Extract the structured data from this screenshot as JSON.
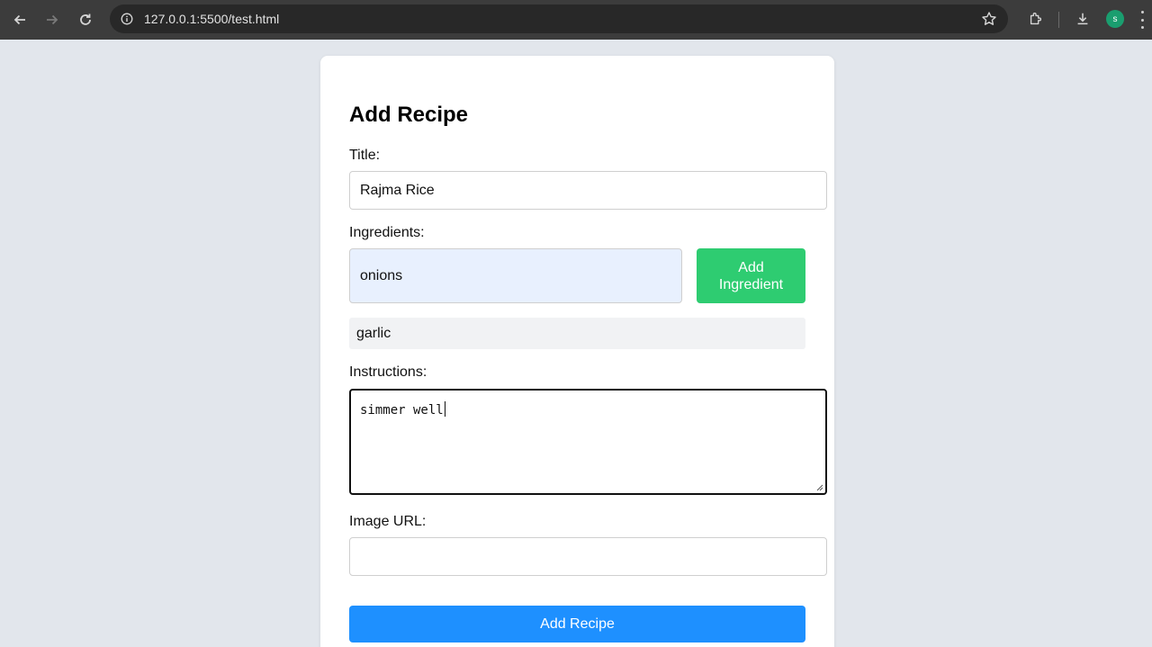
{
  "browser": {
    "url": "127.0.0.1:5500/test.html",
    "profile_initial": "s",
    "icons": {
      "back": "arrow-left-icon",
      "forward": "arrow-right-icon",
      "reload": "reload-icon",
      "info": "info-icon",
      "bookmark": "star-icon",
      "extensions": "puzzle-icon",
      "downloads": "download-icon",
      "menu": "kebab-menu-icon"
    }
  },
  "form": {
    "heading": "Add Recipe",
    "title_label": "Title:",
    "title_value": "Rajma Rice",
    "ingredients_label": "Ingredients:",
    "ingredient_input_value": "onions",
    "add_ingredient_label": "Add Ingredient",
    "ingredients_list": [
      "garlic"
    ],
    "instructions_label": "Instructions:",
    "instructions_value": "simmer well",
    "image_url_label": "Image URL:",
    "image_url_value": "",
    "submit_label": "Add Recipe"
  },
  "colors": {
    "page_bg": "#e2e6ec",
    "add_ingredient_button": "#2ecc71",
    "submit_button": "#1e90ff",
    "autofill_bg": "#e8f0fe"
  }
}
